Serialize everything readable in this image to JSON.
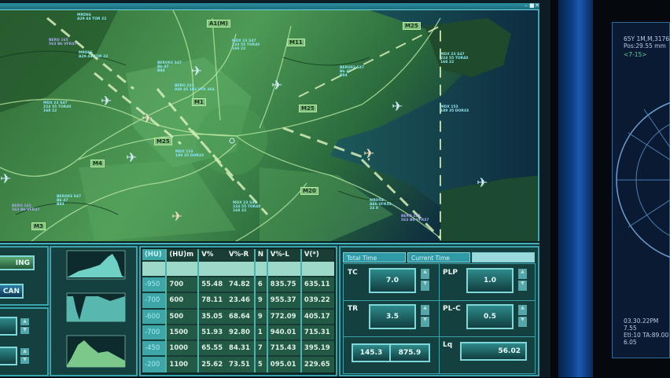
{
  "map": {
    "window_controls": [
      "minimize",
      "maximize",
      "close"
    ],
    "roads": [
      "A1(M)",
      "M1",
      "M11",
      "M25",
      "M25",
      "M25",
      "M4",
      "M3",
      "M20"
    ],
    "flight_tags": [
      "MRD66\nA29 44 TOR 22",
      "BERO 165\n563 Bb VFR47",
      "MDX 23 S47\n224 55 TOR40\n168 22",
      "BERO03 S47\nBb 47\nB84",
      "BERO 223\n040 45 103 VFR 364",
      "MDX 23 S47\n224 55 TOR40\n168 22",
      "MDX 153\n189 35 DOR33",
      "BERO03 S47\nBb 47\nB84",
      "MDX 23 S47\n224 55 TOR40\n168 22",
      "MRD66\nA29 44 TOR 22",
      "BERO03 S47\nBb 47\nB84",
      "BERO 165\n563 Bb VFR47",
      "MDX 153\n189 35 DOR33",
      "MDX 23 S47\n224 55 TOR40\n168 22",
      "MRD54\nA60 VFR33\n33 8",
      "BERO 165\n563 Bb VFR47"
    ]
  },
  "left_panel": {
    "button1": "ING",
    "button2": "CAN"
  },
  "table": {
    "headers": [
      "(HU)",
      "(HU)m",
      "V%",
      "V%-R",
      "N",
      "V%-L",
      "V(*)"
    ],
    "rows": [
      [
        "-950",
        "700",
        "55.48",
        "74.82",
        "6",
        "835.75",
        "635.11"
      ],
      [
        "-700",
        "600",
        "78.11",
        "23.46",
        "9",
        "955.37",
        "039.22"
      ],
      [
        "-600",
        "500",
        "35.05",
        "68.64",
        "9",
        "772.09",
        "405.17"
      ],
      [
        "-700",
        "1500",
        "51.93",
        "92.80",
        "1",
        "940.01",
        "715.31"
      ],
      [
        "-450",
        "1000",
        "65.55",
        "84.31",
        "7",
        "715.43",
        "395.19"
      ],
      [
        "-200",
        "1100",
        "25.62",
        "73.51",
        "5",
        "095.01",
        "229.65"
      ]
    ]
  },
  "controls": {
    "tabs": [
      "Total Time",
      "Current Time"
    ],
    "tc": {
      "label": "TC",
      "value": "7.0"
    },
    "plp": {
      "label": "PLP",
      "value": "1.0"
    },
    "tr": {
      "label": "TR",
      "value": "3.5"
    },
    "plc": {
      "label": "PL-C",
      "value": "0.5"
    },
    "pair": [
      "145.3",
      "875.9"
    ],
    "lq": {
      "label": "Lq",
      "value": "56.02"
    }
  },
  "right_monitor": {
    "line1": "65Y 1M,M,31768",
    "line2": "Pos:29.55 mm",
    "line3": "<7-15>",
    "line4": "03.30.22PM",
    "line5": "7.55",
    "line6": "Etl:10 TA:89.00",
    "line7": "6.05"
  },
  "colors": {
    "map_green": "#3f8a4a",
    "panel": "#14403f",
    "accent": "#3aa3ab",
    "sea": "#123a4a"
  }
}
